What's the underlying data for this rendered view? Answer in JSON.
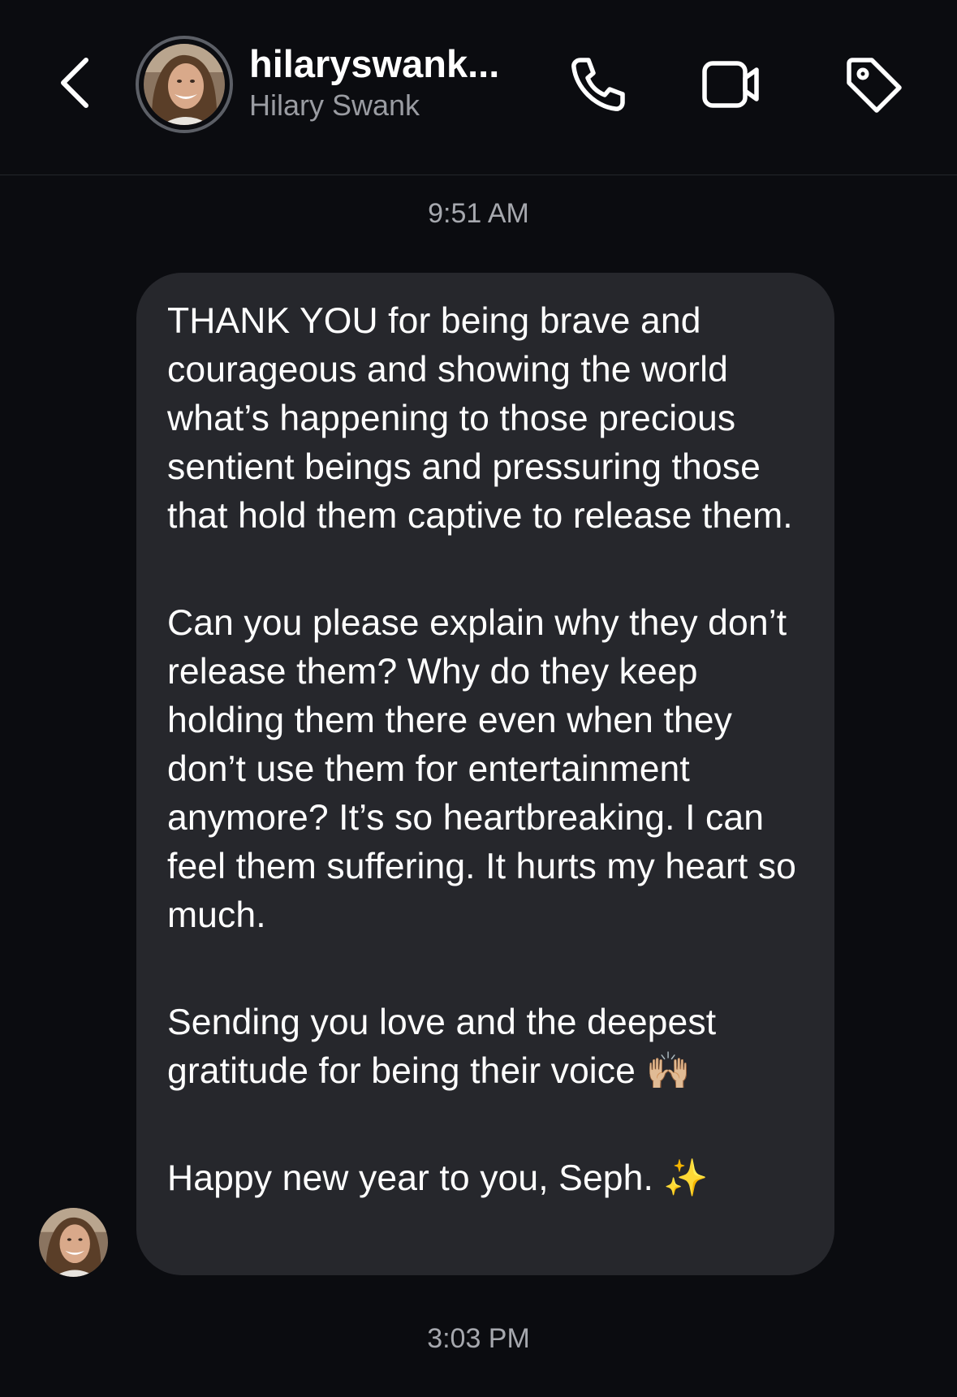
{
  "header": {
    "username": "hilaryswank...",
    "display_name": "Hilary Swank",
    "icons": {
      "back": "chevron-left-icon",
      "call": "phone-icon",
      "video": "video-camera-icon",
      "tag": "tag-icon"
    }
  },
  "conversation": {
    "timestamp_top": "9:51 AM",
    "message": {
      "paragraphs": [
        "THANK YOU for being brave and courageous and showing the world what’s happening to those precious sentient beings and pressuring those that hold them captive to release them.",
        "Can you please explain why they don’t release them? Why do they keep holding them there even when they don’t use them for entertainment anymore? It’s so heartbreaking. I can feel them suffering. It hurts my heart so much.",
        "Sending you love and the deepest gratitude for being their voice 🙌🏼",
        "Happy new year to you, Seph. ✨"
      ]
    },
    "timestamp_bottom": "3:03 PM"
  },
  "colors": {
    "background": "#0b0c10",
    "bubble": "#26272c",
    "secondary_text": "#9a9ca2"
  }
}
